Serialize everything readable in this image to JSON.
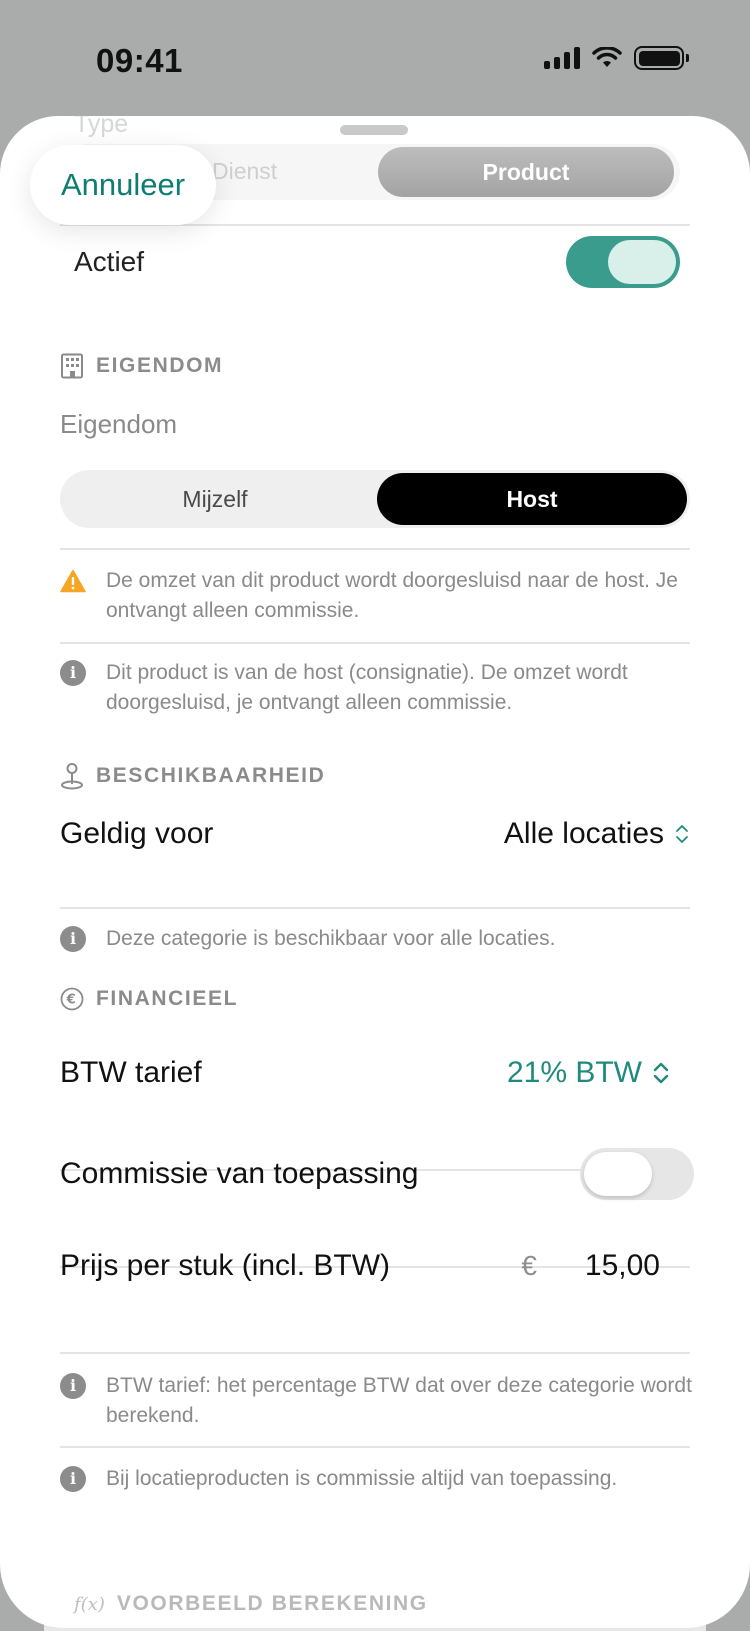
{
  "status_bar": {
    "time": "09:41"
  },
  "top": {
    "type_label": "Type",
    "type_options": [
      "Dienst",
      "Product"
    ],
    "cancel_label": "Annuleer"
  },
  "actief": {
    "label": "Actief",
    "on": true
  },
  "eigendom": {
    "section_title": "EIGENDOM",
    "field_label": "Eigendom",
    "options": [
      "Mijzelf",
      "Host"
    ],
    "selected": "Host",
    "warning": "De omzet van dit product wordt doorgesluisd naar de host. Je ontvangt alleen commissie.",
    "info": "Dit product is van de host (consignatie). De omzet wordt doorgesluisd, je ontvangt alleen commissie."
  },
  "beschikbaarheid": {
    "section_title": "BESCHIKBAARHEID",
    "geldig_label": "Geldig voor",
    "geldig_value": "Alle locaties",
    "info": "Deze categorie is beschikbaar voor alle locaties."
  },
  "financieel": {
    "section_title": "FINANCIEEL",
    "btw_label": "BTW tarief",
    "btw_value": "21% BTW",
    "commissie_label": "Commissie van toepassing",
    "commissie_on": false,
    "prijs_label": "Prijs per stuk (incl. BTW)",
    "currency": "€",
    "prijs_value": "15,00",
    "info_btw": "BTW tarief: het percentage BTW dat over deze categorie wordt berekend.",
    "info_commissie": "Bij locatieproducten is commissie altijd van toepassing."
  },
  "voorbeeld": {
    "icon_text": "f(x)",
    "section_title": "VOORBEELD BEREKENING"
  },
  "colors": {
    "accent": "#1f8a7d",
    "toggle_on": "#3a9c8d",
    "warning": "#f5a623"
  }
}
